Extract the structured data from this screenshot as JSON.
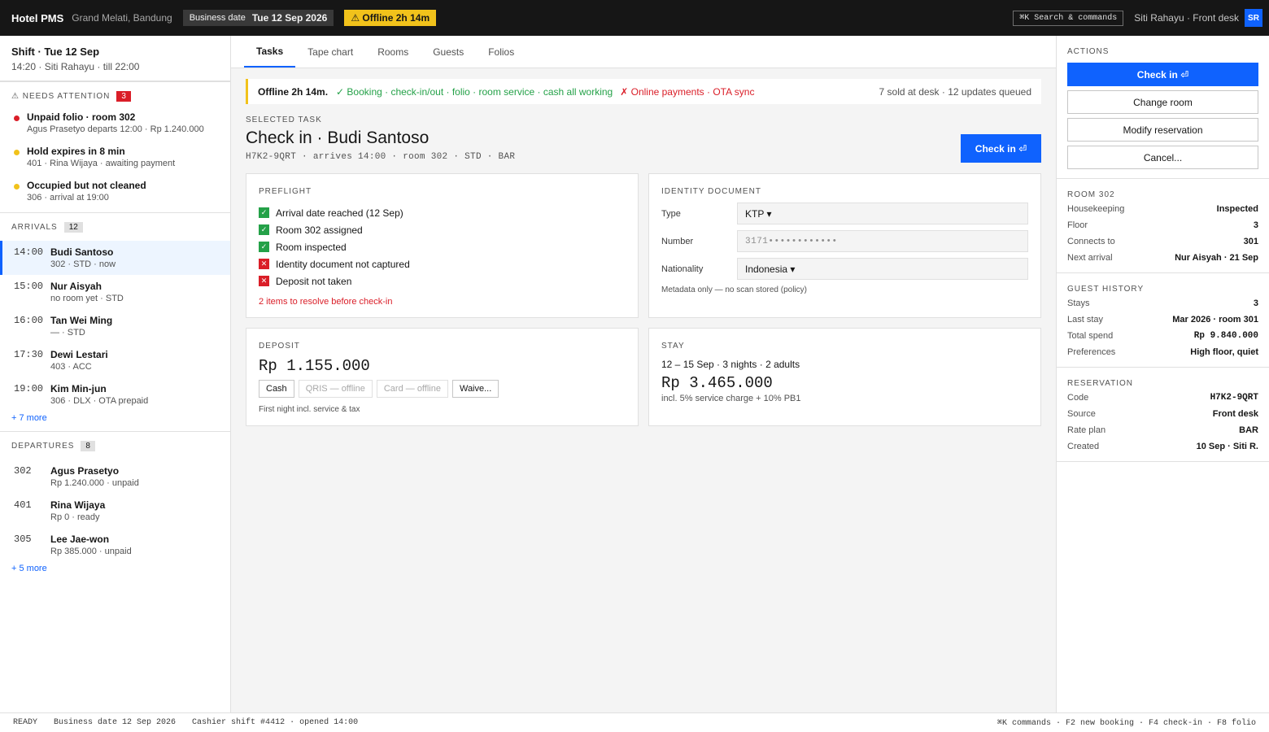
{
  "topbar": {
    "brand": "Hotel PMS",
    "property": "Grand Melati, Bandung",
    "business_date_label": "Business date",
    "business_date_value": "Tue 12 Sep 2026",
    "offline_badge": "⚠ Offline 2h 14m",
    "search_label": "⌘K Search & commands",
    "user": "Siti Rahayu · Front desk",
    "avatar_initials": "SR"
  },
  "shift": {
    "title": "Shift · Tue 12 Sep",
    "subtitle": "14:20 · Siti Rahayu · till 22:00"
  },
  "needs_attention": {
    "heading": "⚠ NEEDS ATTENTION",
    "count": "3",
    "items": [
      {
        "title": "Unpaid folio · room 302",
        "sub": "Agus Prasetyo departs 12:00 · Rp 1.240.000",
        "color": "#da1e28"
      },
      {
        "title": "Hold expires in 8 min",
        "sub": "401 · Rina Wijaya · awaiting payment",
        "color": "#f1c21b"
      },
      {
        "title": "Occupied but not cleaned",
        "sub": "306 · arrival at 19:00",
        "color": "#f1c21b"
      }
    ]
  },
  "arrivals": {
    "heading": "ARRIVALS",
    "count": "12",
    "rows": [
      {
        "time": "14:00",
        "name": "Budi Santoso",
        "sub": "302 · STD · now"
      },
      {
        "time": "15:00",
        "name": "Nur Aisyah",
        "sub": "no room yet · STD"
      },
      {
        "time": "16:00",
        "name": "Tan Wei Ming",
        "sub": "— · STD"
      },
      {
        "time": "17:30",
        "name": "Dewi Lestari",
        "sub": "403 · ACC"
      },
      {
        "time": "19:00",
        "name": "Kim Min-jun",
        "sub": "306 · DLX · OTA prepaid"
      }
    ],
    "more": "+ 7 more"
  },
  "departures": {
    "heading": "DEPARTURES",
    "count": "8",
    "rows": [
      {
        "room": "302",
        "name": "Agus Prasetyo",
        "sub": "Rp 1.240.000 · unpaid"
      },
      {
        "room": "401",
        "name": "Rina Wijaya",
        "sub": "Rp 0 · ready"
      },
      {
        "room": "305",
        "name": "Lee Jae-won",
        "sub": "Rp 385.000 · unpaid"
      }
    ],
    "more": "+ 5 more"
  },
  "tabs": [
    "Tasks",
    "Tape chart",
    "Rooms",
    "Guests",
    "Folios"
  ],
  "banner": {
    "title": "Offline 2h 14m.",
    "ok": "✓ Booking · check-in/out · folio · room service · cash all working",
    "bad": "✗ Online payments · OTA sync",
    "right": "7 sold at desk · 12 updates queued"
  },
  "selected": {
    "label": "SELECTED TASK",
    "title": "Check in · Budi Santoso",
    "meta": "H7K2-9QRT · arrives 14:00 · room 302 · STD · BAR",
    "button": "Check in ⏎"
  },
  "preflight": {
    "label": "PREFLIGHT",
    "items": [
      {
        "text": "Arrival date reached (12 Sep)",
        "status": "pass",
        "mark": "✓"
      },
      {
        "text": "Room 302 assigned",
        "status": "pass",
        "mark": "✓"
      },
      {
        "text": "Room inspected",
        "status": "pass",
        "mark": "✓"
      },
      {
        "text": "Identity document not captured",
        "status": "fail",
        "mark": "✕"
      },
      {
        "text": "Deposit not taken",
        "status": "fail",
        "mark": "✕"
      }
    ],
    "resolve": "2 items to resolve before check-in"
  },
  "identity": {
    "label": "IDENTITY DOCUMENT",
    "type_label": "Type",
    "type_value": "KTP ▾",
    "number_label": "Number",
    "number_value": "3171••••••••••••",
    "nationality_label": "Nationality",
    "nationality_value": "Indonesia ▾",
    "note": "Metadata only — no scan stored (policy)"
  },
  "deposit": {
    "label": "DEPOSIT",
    "amount": "Rp 1.155.000",
    "methods": [
      {
        "label": "Cash",
        "disabled": false
      },
      {
        "label": "QRIS — offline",
        "disabled": true
      },
      {
        "label": "Card — offline",
        "disabled": true
      },
      {
        "label": "Waive...",
        "disabled": false
      }
    ],
    "note": "First night incl. service & tax"
  },
  "stay": {
    "label": "STAY",
    "dates": "12 – 15 Sep · 3 nights · 2 adults",
    "amount": "Rp 3.465.000",
    "note": "incl. 5% service charge + 10% PB1"
  },
  "actions": {
    "label": "ACTIONS",
    "primary": "Check in ⏎",
    "buttons": [
      "Change room",
      "Modify reservation",
      "Cancel..."
    ]
  },
  "room": {
    "label": "ROOM 302",
    "rows": [
      {
        "k": "Housekeeping",
        "v": "Inspected"
      },
      {
        "k": "Floor",
        "v": "3"
      },
      {
        "k": "Connects to",
        "v": "301"
      },
      {
        "k": "Next arrival",
        "v": "Nur Aisyah · 21 Sep"
      }
    ]
  },
  "history": {
    "label": "GUEST HISTORY",
    "rows": [
      {
        "k": "Stays",
        "v": "3"
      },
      {
        "k": "Last stay",
        "v": "Mar 2026 · room 301"
      },
      {
        "k": "Total spend",
        "v": "Rp 9.840.000",
        "mono": true
      },
      {
        "k": "Preferences",
        "v": "High floor, quiet"
      }
    ]
  },
  "reservation": {
    "label": "RESERVATION",
    "rows": [
      {
        "k": "Code",
        "v": "H7K2-9QRT",
        "mono": true
      },
      {
        "k": "Source",
        "v": "Front desk"
      },
      {
        "k": "Rate plan",
        "v": "BAR"
      },
      {
        "k": "Created",
        "v": "10 Sep · Siti R."
      }
    ]
  },
  "statusbar": {
    "state": "READY",
    "bizdate": "Business date 12 Sep 2026",
    "shift": "Cashier shift #4412 · opened 14:00",
    "hotkeys": "⌘K commands · F2 new booking · F4 check-in · F8 folio"
  }
}
